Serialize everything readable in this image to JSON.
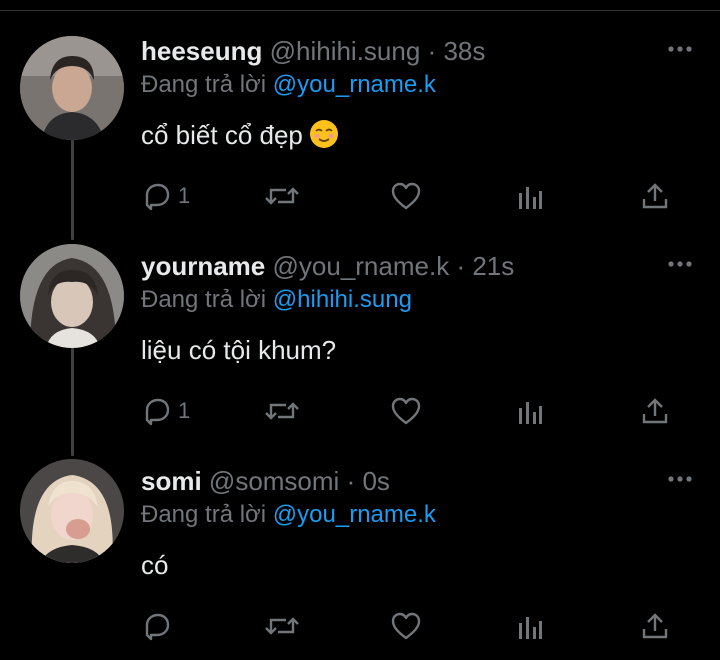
{
  "reply_prefix": "Đang trả lời",
  "tweets": [
    {
      "name": "heeseung",
      "handle": "@hihihi.sung",
      "separator": "·",
      "time": "38s",
      "reply_to": "@you_rname.k",
      "text": "cổ biết cổ đẹp",
      "emoji": "smiling-face-icon",
      "reply_count": "1"
    },
    {
      "name": "yourname",
      "handle": "@you_rname.k",
      "separator": "·",
      "time": "21s",
      "reply_to": "@hihihi.sung",
      "text": "liệu có tội khum?",
      "reply_count": "1"
    },
    {
      "name": "somi",
      "handle": "@somsomi",
      "separator": "·",
      "time": "0s",
      "reply_to": "@you_rname.k",
      "text": "có",
      "reply_count": ""
    }
  ],
  "colors": {
    "background": "#000000",
    "text": "#e7e9ea",
    "muted": "#71767b",
    "link": "#1d9bf0",
    "thread_line": "#3e4144"
  }
}
